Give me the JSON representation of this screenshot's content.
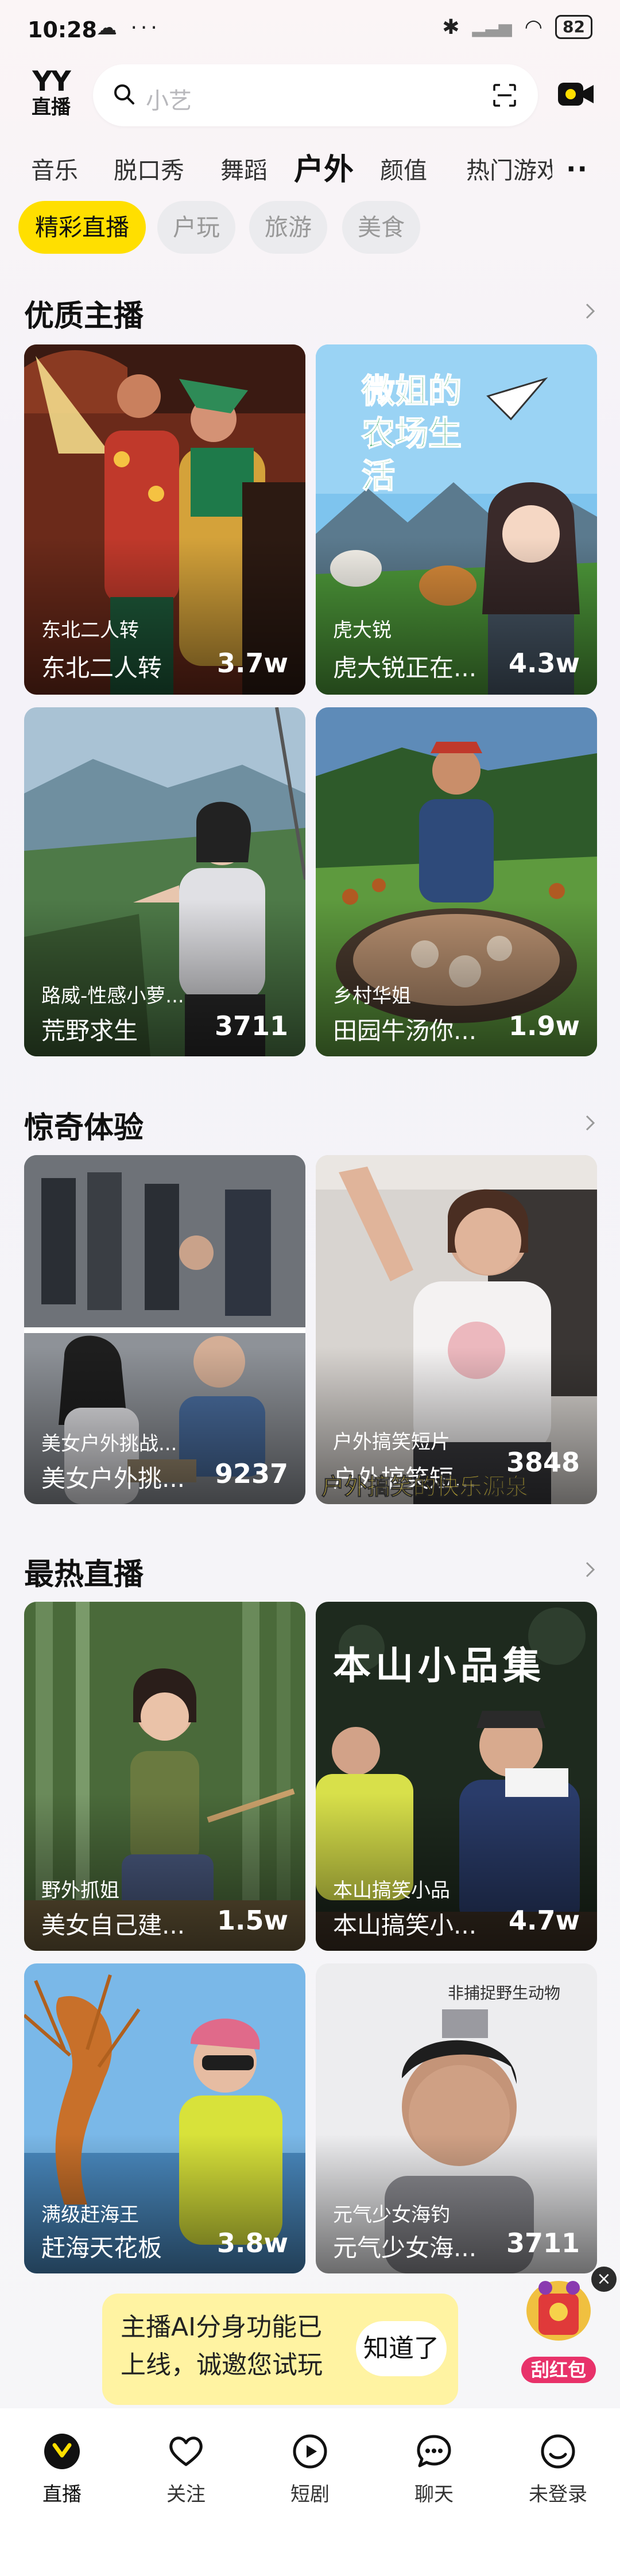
{
  "status": {
    "time": "10:28",
    "battery": "82"
  },
  "header": {
    "logo_top": "YY",
    "logo_bottom": "直播",
    "search_placeholder": "小艺"
  },
  "tabs": [
    "音乐",
    "脱口秀",
    "舞蹈",
    "户外",
    "颜值",
    "热门游戏"
  ],
  "active_tab": "户外",
  "subtabs": [
    "精彩直播",
    "户玩",
    "旅游",
    "美食"
  ],
  "sections": [
    {
      "title": "优质主播",
      "cards": [
        {
          "tag": "东北二人转",
          "title": "东北二人转",
          "count": "3.7w"
        },
        {
          "tag": "虎大锐",
          "title": "虎大锐正在...",
          "count": "4.3w",
          "overlay_text": "微姐的农场生活"
        },
        {
          "tag": "路威-性感小萝...",
          "title": "荒野求生",
          "count": "3711"
        },
        {
          "tag": "乡村华姐",
          "title": "田园牛汤你...",
          "count": "1.9w"
        }
      ]
    },
    {
      "title": "惊奇体验",
      "cards": [
        {
          "tag": "美女户外挑战...",
          "title": "美女户外挑...",
          "count": "9237"
        },
        {
          "tag": "户外搞笑短片",
          "title": "户外搞笑短...",
          "count": "3848",
          "overlay_text": "户外搞笑的快乐源泉"
        }
      ]
    },
    {
      "title": "最热直播",
      "cards": [
        {
          "tag": "野外抓姐",
          "title": "美女自己建...",
          "count": "1.5w"
        },
        {
          "tag": "本山搞笑小品",
          "title": "本山搞笑小...",
          "count": "4.7w",
          "overlay_text": "本山小品集"
        },
        {
          "tag": "满级赶海王",
          "title": "赶海天花板",
          "count": "3.8w"
        },
        {
          "tag": "元气少女海钓",
          "title": "元气少女海...",
          "count": "3711",
          "overlay_text": "非捕捉野生动物"
        }
      ]
    }
  ],
  "toast": {
    "message": "主播AI分身功能已上线，诚邀您试玩",
    "button": "知道了"
  },
  "float_badge": {
    "label": "刮红包"
  },
  "bottom_nav": [
    "直播",
    "关注",
    "短剧",
    "聊天",
    "未登录"
  ],
  "colors": {
    "accent": "#FFDF00",
    "toast_bg": "#FFF3A2"
  }
}
